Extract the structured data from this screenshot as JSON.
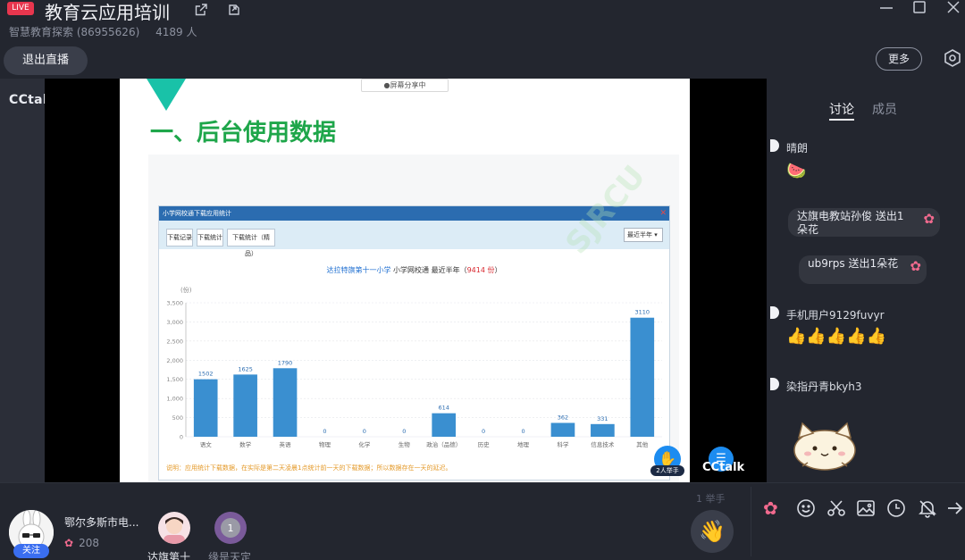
{
  "header": {
    "live_badge": "LIVE",
    "title": "教育云应用培训",
    "channel": "智慧教育探索 (86955626)",
    "viewers": "4189 人"
  },
  "toolbar": {
    "exit_label": "退出直播",
    "more_label": "更多"
  },
  "video": {
    "cctalk_mark": "CCtalk",
    "share_status": "●屏幕分享中",
    "slide_heading": "一、后台使用数据",
    "window_title": "小学网校通下载应用统计",
    "window_close": "✕",
    "tabs": [
      "下载记录",
      "下载统计",
      "下载统计（精品）"
    ],
    "range_select": "最近半年 ▾",
    "chart_title_org": "达拉特旗第十一小学",
    "chart_title_mid": " 小学网校通 最近半年（",
    "chart_title_total": "9414 份",
    "chart_title_end": "）",
    "footnote": "说明：应用统计下载数据，在实际是第二天凌晨1点统计前一天的下载数据；所以数据存在一天的延迟。",
    "watermark": "SJRCU",
    "raise_hand_count": "2人举手",
    "cctalk_logo": "CCtalk"
  },
  "chart_data": {
    "type": "bar",
    "ylabel": "(份)",
    "ylim": [
      0,
      3500
    ],
    "yticks": [
      "0",
      "500",
      "1,000",
      "1,500",
      "2,000",
      "2,500",
      "3,000",
      "3,500"
    ],
    "categories": [
      "语文",
      "数学",
      "英语",
      "物理",
      "化学",
      "生物",
      "政治（品德）",
      "历史",
      "地理",
      "科学",
      "信息技术",
      "其他"
    ],
    "values": [
      1502,
      1625,
      1790,
      0,
      0,
      0,
      614,
      0,
      0,
      362,
      331,
      3110
    ],
    "value_labels": [
      "1502",
      "1625",
      "1790",
      "0",
      "0",
      "0",
      "614",
      "0",
      "0",
      "362",
      "331",
      "3110"
    ],
    "bar_color": "#3a8fd0",
    "grid": true
  },
  "panel": {
    "tab_discuss": "讨论",
    "tab_members": "成员",
    "messages": [
      {
        "user": "晴朗",
        "emoji": "🍉"
      },
      {
        "gift": "达旗电教站孙俊 送出1朵花",
        "flower": "✿"
      },
      {
        "gift": "ub9rps 送出1朵花",
        "flower": "✿"
      },
      {
        "user": "手机用户9129fuvyr",
        "emoji": "👍👍👍👍👍"
      },
      {
        "user": "染指丹青bkyh3"
      }
    ]
  },
  "bottom": {
    "host_name": "鄂尔多斯市电...",
    "follow_label": "关注",
    "host_likes": "208",
    "viewer1_name": "达旗第十",
    "viewer2_name": "缘是天定",
    "viewer2_badge": "1",
    "hand_count": "1 举手",
    "hand_icon": "👋"
  },
  "colors": {
    "live_red": "#e8364e",
    "accent_blue": "#1c8cf0",
    "heading_green": "#1ea64a",
    "flower_pink": "#f16a8e"
  },
  "icons": [
    "share-icon",
    "popout-icon",
    "minimize-icon",
    "maximize-icon",
    "close-icon",
    "settings-icon",
    "flower-icon",
    "emoji-icon",
    "scissors-icon",
    "image-icon",
    "clock-icon",
    "mute-bell-icon",
    "send-icon"
  ]
}
